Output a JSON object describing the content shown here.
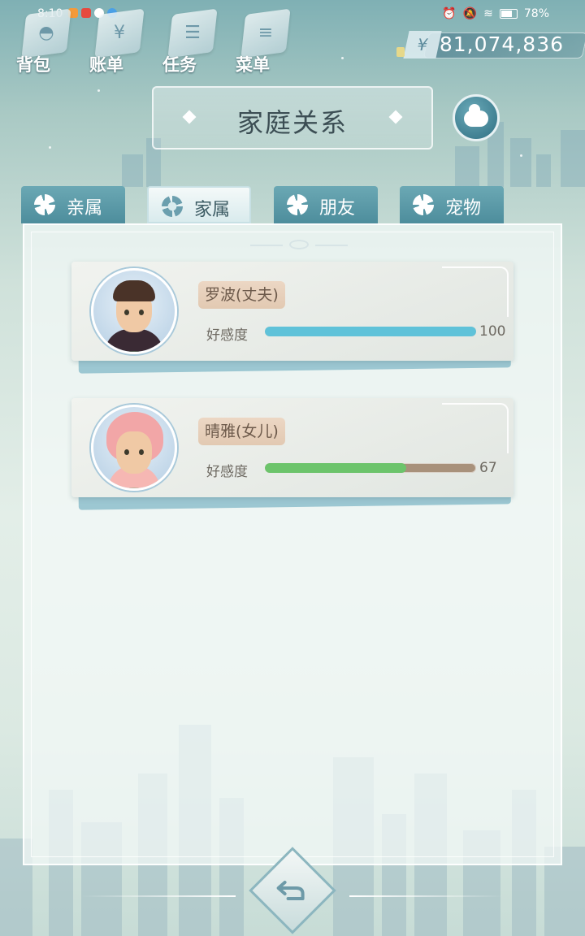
{
  "status_bar": {
    "time": "8:10",
    "battery": "78%"
  },
  "nav": [
    {
      "id": "bag",
      "label": "背包",
      "icon": "bag-icon"
    },
    {
      "id": "bill",
      "label": "账单",
      "icon": "yen-bill-icon"
    },
    {
      "id": "task",
      "label": "任务",
      "icon": "task-list-icon"
    },
    {
      "id": "menu",
      "label": "菜单",
      "icon": "menu-icon"
    }
  ],
  "money": {
    "symbol": "¥",
    "value": "81,074,836"
  },
  "title": "家庭关系",
  "tabs": [
    {
      "label": "亲属",
      "active": false
    },
    {
      "label": "家属",
      "active": true
    },
    {
      "label": "朋友",
      "active": false
    },
    {
      "label": "宠物",
      "active": false
    }
  ],
  "members": [
    {
      "name": "罗波(丈夫)",
      "affinity_label": "好感度",
      "affinity": 100,
      "affinity_max": 100,
      "bar_color": "#5fc2d9"
    },
    {
      "name": "晴雅(女儿)",
      "affinity_label": "好感度",
      "affinity": 67,
      "affinity_max": 100,
      "bar_color": "#6cc46b"
    }
  ],
  "colors": {
    "accent": "#4d8d9c",
    "badge": "#e2c9b2",
    "track": "#a8917b"
  }
}
